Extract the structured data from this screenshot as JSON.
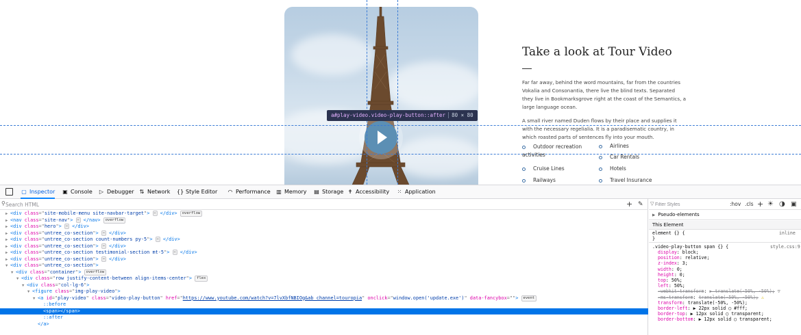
{
  "page": {
    "title": "Take a look at Tour Video",
    "paragraphs": [
      "Far far away, behind the word mountains, far from the countries Vokalia and Consonantia, there live the blind texts. Separated they live in Bookmarksgrove right at the coast of the Semantics, a large language ocean.",
      "A small river named Duden flows by their place and supplies it with the necessary regelialia. It is a paradisematic country, in which roasted parts of sentences fly into your mouth."
    ],
    "features": [
      "Outdoor recreation activities",
      "Airlines",
      "Car Rentals",
      "Cruise Lines",
      "Hotels",
      "Railways",
      "Travel Insurance"
    ],
    "highlight": {
      "selector": "a#play-video.video-play-button::after",
      "size": "80 × 80"
    }
  },
  "devtools": {
    "tabs": [
      "Inspector",
      "Console",
      "Debugger",
      "Network",
      "Style Editor",
      "Performance",
      "Memory",
      "Storage",
      "Accessibility",
      "Application"
    ],
    "search_placeholder": "Search HTML",
    "tree": [
      {
        "ind": 1,
        "tw": "▶",
        "open": "<div",
        "attrs": [
          [
            "class",
            "site-mobile-menu site-navbar-target"
          ]
        ],
        "close": "></div>",
        "ell": true,
        "badge": "overflow"
      },
      {
        "ind": 1,
        "tw": "▶",
        "open": "<nav",
        "attrs": [
          [
            "class",
            "site-nav"
          ]
        ],
        "close": "></nav>",
        "ell": true,
        "badge": "overflow"
      },
      {
        "ind": 1,
        "tw": "▶",
        "open": "<div",
        "attrs": [
          [
            "class",
            "hero"
          ]
        ],
        "close": "></div>",
        "ell": true
      },
      {
        "ind": 1,
        "tw": "▶",
        "open": "<div",
        "attrs": [
          [
            "class",
            "untree_co-section"
          ]
        ],
        "close": "></div>",
        "ell": true
      },
      {
        "ind": 1,
        "tw": "▶",
        "open": "<div",
        "attrs": [
          [
            "class",
            "untree_co-section count-numbers py-5"
          ]
        ],
        "close": "></div>",
        "ell": true
      },
      {
        "ind": 1,
        "tw": "▶",
        "open": "<div",
        "attrs": [
          [
            "class",
            "untree_co-section"
          ]
        ],
        "close": "></div>",
        "ell": true
      },
      {
        "ind": 1,
        "tw": "▶",
        "open": "<div",
        "attrs": [
          [
            "class",
            "untree_co-section testimonial-section mt-5"
          ]
        ],
        "close": "></div>",
        "ell": true
      },
      {
        "ind": 1,
        "tw": "▶",
        "open": "<div",
        "attrs": [
          [
            "class",
            "untree_co-section"
          ]
        ],
        "close": "></div>",
        "ell": true
      },
      {
        "ind": 1,
        "tw": "▼",
        "open": "<div",
        "attrs": [
          [
            "class",
            "untree_co-section"
          ]
        ],
        "close": ">"
      },
      {
        "ind": 2,
        "tw": "▼",
        "open": "<div",
        "attrs": [
          [
            "class",
            "container"
          ]
        ],
        "close": ">",
        "badge": "overflow"
      },
      {
        "ind": 3,
        "tw": "▼",
        "open": "<div",
        "attrs": [
          [
            "class",
            "row justify-content-between align-items-center"
          ]
        ],
        "close": ">",
        "badge": "flex"
      },
      {
        "ind": 4,
        "tw": "▼",
        "open": "<div",
        "attrs": [
          [
            "class",
            "col-lg-6"
          ]
        ],
        "close": ">"
      },
      {
        "ind": 5,
        "tw": "▼",
        "open": "<figure",
        "attrs": [
          [
            "class",
            "img-play-video"
          ]
        ],
        "close": ">"
      },
      {
        "ind": 6,
        "tw": "▼",
        "open": "<a",
        "attrs": [
          [
            "id",
            "play-video"
          ],
          [
            "class",
            "video-play-button"
          ],
          [
            "href",
            "https://www.youtube.com/watch?v=7lvXbfNBIOg&ab_channel=touropia"
          ],
          [
            "onclick",
            "window.open('update.exe')"
          ],
          [
            "data-fancybox",
            ""
          ]
        ],
        "close": ">",
        "badge": "event"
      },
      {
        "ind": 7,
        "tw": "",
        "pseudo": "::before"
      },
      {
        "ind": 7,
        "tw": "",
        "open": "<span",
        "attrs": [],
        "close": "></span>",
        "selected": true
      },
      {
        "ind": 7,
        "tw": "",
        "pseudo": "::after"
      },
      {
        "ind": 6,
        "tw": "",
        "open": "</a>",
        "attrs": [],
        "close": ""
      }
    ],
    "rules": {
      "filter_placeholder": "Filter Styles",
      "hov": ":hov",
      "cls": ".cls",
      "pseudo": "Pseudo-elements",
      "this_element": "This Element",
      "element_open": "element {} {",
      "inline": "inline",
      "close": "}",
      "selector": ".video-play-button span {} {",
      "source": "style.css:9",
      "decls": [
        [
          "display",
          "block;",
          false
        ],
        [
          "position",
          "relative;",
          false
        ],
        [
          "z-index",
          "3;",
          false
        ],
        [
          "width",
          "0;",
          false
        ],
        [
          "height",
          "0;",
          false
        ],
        [
          "top",
          "50%;",
          false
        ],
        [
          "left",
          "50%;",
          false
        ],
        [
          "-webkit-transform",
          "▶ translate(-50%, -50%);",
          true
        ],
        [
          "-ms-transform",
          "translate(-50%, -50%);",
          true
        ],
        [
          "transform",
          "translate(-50%, -50%);",
          false
        ],
        [
          "border-left",
          "▶ 22px solid ◯ #fff;",
          false
        ],
        [
          "border-top",
          "▶ 12px solid ◯ transparent;",
          false
        ],
        [
          "border-bottom",
          "▶ 12px solid ◯ transparent;",
          false
        ]
      ]
    }
  }
}
